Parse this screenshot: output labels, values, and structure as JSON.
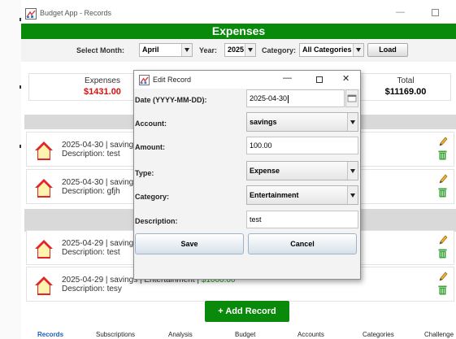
{
  "window": {
    "title": "Budget App - Records",
    "minimize_glyph": "—",
    "header_title": "Expenses"
  },
  "filters": {
    "month_label": "Select Month:",
    "month_value": "April",
    "year_label": "Year:",
    "year_value": "2025",
    "category_label": "Category:",
    "category_value": "All Categories",
    "load_label": "Load"
  },
  "summary": {
    "expenses_label": "Expenses",
    "expenses_value": "$1431.00",
    "total_label": "Total",
    "total_value": "$11169.00"
  },
  "records": [
    {
      "line1": "2025-04-30 | savings",
      "line2": "Description: test"
    },
    {
      "line1": "2025-04-30 | savings",
      "line2": "Description: gfjh"
    },
    {
      "line1": "2025-04-29 | savings",
      "line2": "Description: test"
    },
    {
      "line1_prefix": "2025-04-29 | savings | Entertainment | ",
      "line1_amount": "$1000.00",
      "line2": "Description: tesy"
    }
  ],
  "add_record_label": "+ Add Record",
  "tabs": [
    "Records",
    "Subscriptions",
    "Analysis",
    "Budget",
    "Accounts",
    "Categories",
    "Challenge"
  ],
  "dialog": {
    "title": "Edit Record",
    "minimize_glyph": "—",
    "close_glyph": "✕",
    "date_label": "Date (YYYY-MM-DD):",
    "date_value": "2025-04-30",
    "account_label": "Account:",
    "account_value": "savings",
    "amount_label": "Amount:",
    "amount_value": "100.00",
    "type_label": "Type:",
    "type_value": "Expense",
    "category_label": "Category:",
    "category_value": "Entertainment",
    "description_label": "Description:",
    "description_value": "test",
    "save_label": "Save",
    "cancel_label": "Cancel"
  },
  "colors": {
    "header_green": "#0a8a0a",
    "amount_red": "#d61010",
    "amount_green": "#1a9a1a",
    "active_tab": "#1e5bb8"
  },
  "icons": [
    "app-icon",
    "house-icon",
    "pencil-icon",
    "trash-icon",
    "calendar-icon",
    "chevron-down-icon"
  ]
}
